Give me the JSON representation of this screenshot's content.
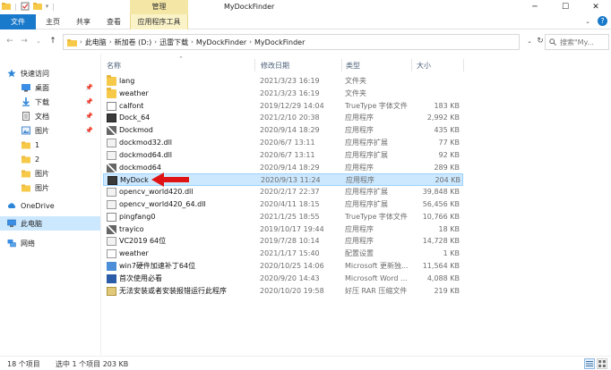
{
  "window": {
    "title": "MyDockFinder",
    "ctx_group": "管理",
    "controls": [
      "─",
      "☐",
      "✕"
    ]
  },
  "ribbon": {
    "tabs": [
      "文件",
      "主页",
      "共享",
      "查看",
      "应用程序工具"
    ],
    "help": "?"
  },
  "address": {
    "crumbs": [
      "此电脑",
      "新加卷 (D:)",
      "迅雷下载",
      "MyDockFinder",
      "MyDockFinder"
    ],
    "search_placeholder": "搜索\"My..."
  },
  "nav": {
    "items": [
      {
        "label": "快速访问",
        "icon": "star-icon",
        "pinned": false
      },
      {
        "label": "桌面",
        "icon": "desktop-icon",
        "pinned": true
      },
      {
        "label": "下载",
        "icon": "download-icon",
        "pinned": true
      },
      {
        "label": "文档",
        "icon": "document-icon",
        "pinned": true
      },
      {
        "label": "图片",
        "icon": "picture-icon",
        "pinned": true
      },
      {
        "label": "1",
        "icon": "folder-icon",
        "pinned": false
      },
      {
        "label": "2",
        "icon": "folder-icon",
        "pinned": false
      },
      {
        "label": "图片",
        "icon": "folder-icon",
        "pinned": false
      },
      {
        "label": "图片",
        "icon": "folder-icon",
        "pinned": false
      },
      {
        "label": "OneDrive",
        "icon": "cloud-icon",
        "pinned": false
      },
      {
        "label": "此电脑",
        "icon": "computer-icon",
        "pinned": false
      },
      {
        "label": "网络",
        "icon": "network-icon",
        "pinned": false
      }
    ]
  },
  "columns": {
    "name": "名称",
    "date": "修改日期",
    "type": "类型",
    "size": "大小"
  },
  "files": [
    {
      "name": "lang",
      "date": "2021/3/23 16:19",
      "type": "文件夹",
      "size": "",
      "icon": "folder-icon"
    },
    {
      "name": "weather",
      "date": "2021/3/23 16:19",
      "type": "文件夹",
      "size": "",
      "icon": "folder-icon"
    },
    {
      "name": "calfont",
      "date": "2019/12/29 14:04",
      "type": "TrueType 字体文件",
      "size": "183 KB",
      "icon": "font-file-icon"
    },
    {
      "name": "Dock_64",
      "date": "2021/2/10 20:38",
      "type": "应用程序",
      "size": "2,992 KB",
      "icon": "app-icon"
    },
    {
      "name": "Dockmod",
      "date": "2020/9/14 18:29",
      "type": "应用程序",
      "size": "435 KB",
      "icon": "tool-icon"
    },
    {
      "name": "dockmod32.dll",
      "date": "2020/6/7 13:11",
      "type": "应用程序扩展",
      "size": "77 KB",
      "icon": "dll-icon"
    },
    {
      "name": "dockmod64.dll",
      "date": "2020/6/7 13:11",
      "type": "应用程序扩展",
      "size": "92 KB",
      "icon": "dll-icon"
    },
    {
      "name": "dockmod64",
      "date": "2020/9/14 18:29",
      "type": "应用程序",
      "size": "289 KB",
      "icon": "tool-icon"
    },
    {
      "name": "MyDock",
      "date": "2020/9/13 11:24",
      "type": "应用程序",
      "size": "204 KB",
      "icon": "app-icon"
    },
    {
      "name": "opencv_world420.dll",
      "date": "2020/2/17 22:37",
      "type": "应用程序扩展",
      "size": "39,848 KB",
      "icon": "dll-icon"
    },
    {
      "name": "opencv_world420_64.dll",
      "date": "2020/4/11 18:15",
      "type": "应用程序扩展",
      "size": "56,456 KB",
      "icon": "dll-icon"
    },
    {
      "name": "pingfang0",
      "date": "2021/1/25 18:55",
      "type": "TrueType 字体文件",
      "size": "10,766 KB",
      "icon": "font-file-icon"
    },
    {
      "name": "trayico",
      "date": "2019/10/17 19:44",
      "type": "应用程序",
      "size": "18 KB",
      "icon": "tool-icon"
    },
    {
      "name": "VC2019 64位",
      "date": "2019/7/28 10:14",
      "type": "应用程序",
      "size": "14,728 KB",
      "icon": "installer-icon"
    },
    {
      "name": "weather",
      "date": "2021/1/17 15:40",
      "type": "配置设置",
      "size": "1 KB",
      "icon": "config-icon"
    },
    {
      "name": "win7硬件加速补丁64位",
      "date": "2020/10/25 14:06",
      "type": "Microsoft 更新独...",
      "size": "11,564 KB",
      "icon": "msu-icon"
    },
    {
      "name": "首次使用必看",
      "date": "2020/9/20 14:43",
      "type": "Microsoft Word ...",
      "size": "4,088 KB",
      "icon": "word-icon"
    },
    {
      "name": "无法安装或者安装报错运行此程序",
      "date": "2020/10/20 19:58",
      "type": "好压 RAR 压缩文件",
      "size": "219 KB",
      "icon": "zip-icon"
    }
  ],
  "selected_row": 8,
  "status": {
    "count": "18 个项目",
    "selection": "选中 1 个项目  203 KB"
  },
  "colors": {
    "accent": "#1979ca",
    "selection": "#cce8ff",
    "ctx_tab": "#f4e7a5",
    "annotation_arrow": "#e01414"
  }
}
